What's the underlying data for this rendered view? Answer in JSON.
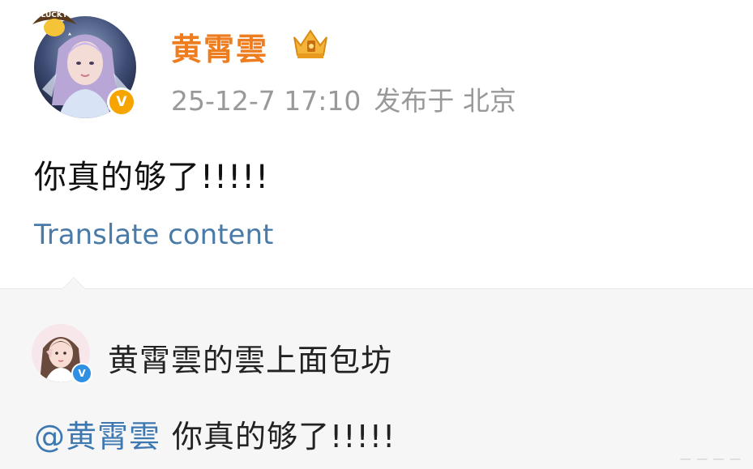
{
  "post": {
    "author_name": "黄霄雲",
    "avatar_badge_text": "LUCKY",
    "verified_mark": "V",
    "timestamp": "25-12-7 17:10",
    "location": "发布于 北京",
    "text": "你真的够了!!!!!",
    "translate_label": "Translate content",
    "icons": {
      "crown": "crown-badge-icon",
      "verified": "verified-gold-icon"
    },
    "colors": {
      "author": "#ee7d1f",
      "link": "#4a7aa8",
      "meta": "#999999"
    }
  },
  "repost": {
    "source_name": "黄霄雲的雲上面包坊",
    "verified_mark": "V",
    "mention": "@黄霄雲",
    "text": "你真的够了!!!!!",
    "icons": {
      "verified": "verified-blue-icon"
    },
    "colors": {
      "background": "#f6f6f6",
      "mention": "#3d78b0"
    }
  },
  "watermark": "— — — —"
}
